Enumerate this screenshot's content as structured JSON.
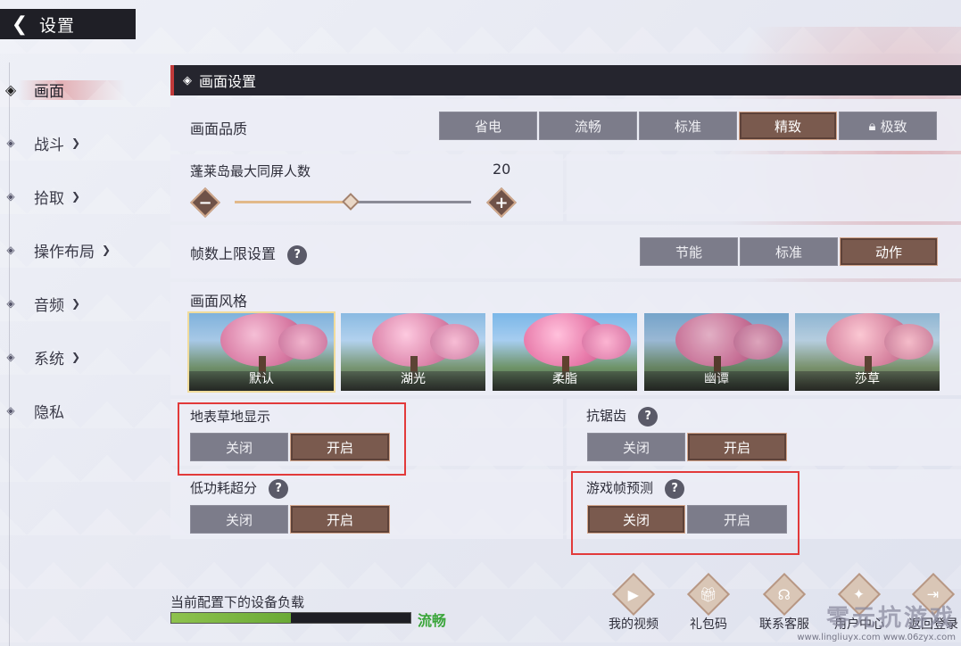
{
  "header": {
    "title": "设置",
    "back_icon": "back-arrow-icon"
  },
  "sidebar": {
    "items": [
      {
        "label": "画面",
        "active": true,
        "chevron": false
      },
      {
        "label": "战斗",
        "chevron": true
      },
      {
        "label": "拾取",
        "chevron": true
      },
      {
        "label": "操作布局",
        "chevron": true
      },
      {
        "label": "音频",
        "chevron": true
      },
      {
        "label": "系统",
        "chevron": true
      },
      {
        "label": "隐私",
        "chevron": false
      }
    ]
  },
  "section": {
    "title": "画面设置"
  },
  "quality": {
    "label": "画面品质",
    "options": [
      "省电",
      "流畅",
      "标准",
      "精致",
      "极致"
    ],
    "selected": "精致",
    "locked": "极致"
  },
  "max_players": {
    "label": "蓬莱岛最大同屏人数",
    "value": "20",
    "fraction": 0.49
  },
  "fps": {
    "label": "帧数上限设置",
    "options": [
      "节能",
      "标准",
      "动作"
    ],
    "selected": "动作"
  },
  "style": {
    "label": "画面风格",
    "options": [
      "默认",
      "湖光",
      "柔脂",
      "幽谭",
      "莎草"
    ],
    "selected": "默认"
  },
  "toggles": {
    "off": "关闭",
    "on": "开启",
    "ground_grass": {
      "label": "地表草地显示",
      "value": "开启"
    },
    "antialias": {
      "label": "抗锯齿",
      "value": "开启"
    },
    "low_power_sr": {
      "label": "低功耗超分",
      "value": "开启"
    },
    "frame_predict": {
      "label": "游戏帧预测",
      "value": "关闭"
    }
  },
  "footer": {
    "load_label": "当前配置下的设备负载",
    "load_fraction": 0.5,
    "load_status": "流畅",
    "buttons": [
      {
        "label": "我的视频",
        "icon": "play-icon"
      },
      {
        "label": "礼包码",
        "icon": "gift-icon"
      },
      {
        "label": "联系客服",
        "icon": "headset-icon"
      },
      {
        "label": "用户中心",
        "icon": "user-center-icon"
      },
      {
        "label": "返回登录",
        "icon": "logout-icon"
      }
    ]
  },
  "watermark": {
    "title": "零元抗游戏",
    "url1": "www.lingliuyx.com",
    "url2": "www.06zyx.com"
  },
  "colors": {
    "accent": "#c23a3a",
    "selected_bg": "#7a5a4e",
    "load_green": "#6aaa36"
  }
}
